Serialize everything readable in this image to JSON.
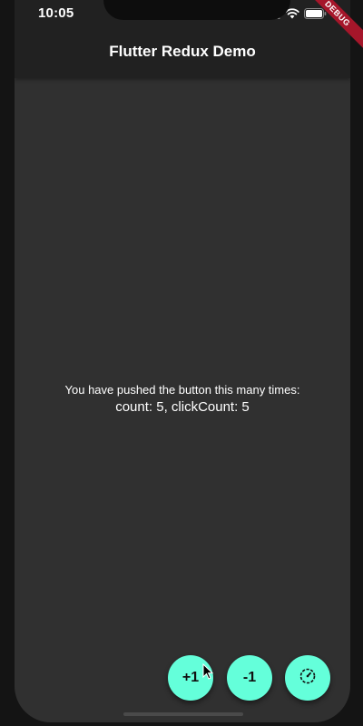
{
  "status_bar": {
    "time": "10:05",
    "icons": [
      "signal-icon",
      "wifi-icon",
      "battery-icon"
    ]
  },
  "debug_banner": {
    "label": "DEBUG",
    "color": "#a5162a"
  },
  "appbar": {
    "title": "Flutter Redux Demo"
  },
  "main": {
    "message": "You have pushed the button this many times:",
    "counter_text": "count: 5, clickCount: 5"
  },
  "fabs": {
    "increment_label": "+1",
    "decrement_label": "-1",
    "third_icon": "timer-icon",
    "accent_color": "#64ffda"
  },
  "colors": {
    "background": "#303030",
    "appbar": "#212121",
    "text": "#ffffff"
  }
}
